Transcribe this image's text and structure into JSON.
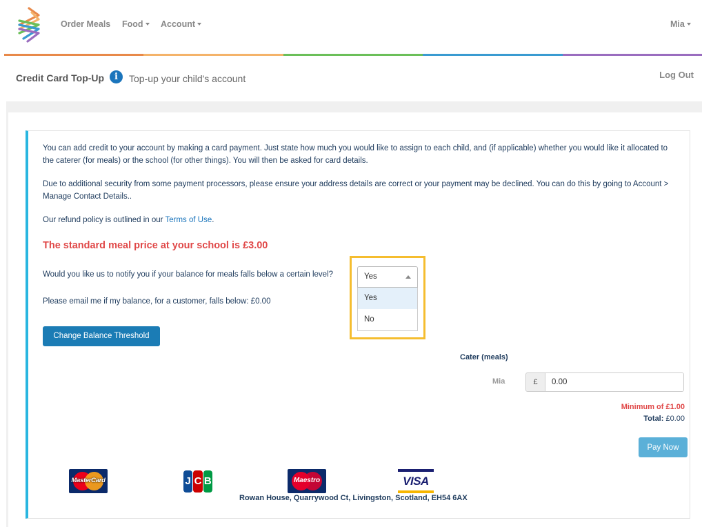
{
  "nav": {
    "items": [
      {
        "label": "Order Meals",
        "has_caret": false
      },
      {
        "label": "Food",
        "has_caret": true
      },
      {
        "label": "Account",
        "has_caret": true
      }
    ],
    "user_menu": "Mia"
  },
  "header": {
    "title": "Credit Card Top-Up",
    "subtitle": "Top-up your child's account",
    "info_icon": "i",
    "logout_label": "Log Out"
  },
  "intro": {
    "paragraph1": "You can add credit to your account by making a card payment. Just state how much you would like to assign to each child, and (if applicable) whether you would like it allocated to the caterer (for meals) or the school (for other things). You will then be asked for card details.",
    "paragraph2": "Due to additional security from some payment processors, please ensure your address details are correct or your payment may be declined. You can do this by going to Account > Manage Contact Details..",
    "refund_prefix": "Our refund policy is outlined in our ",
    "refund_link": "Terms of Use",
    "refund_suffix": "."
  },
  "meal_price_text": "The standard meal price at your school is £3.00",
  "notify": {
    "question": "Would you like us to notify you if your balance for meals falls below a certain level?",
    "threshold_text": "Please email me if my balance, for a customer, falls below: £0.00",
    "button_label": "Change Balance Threshold",
    "select": {
      "value": "Yes",
      "options": [
        "Yes",
        "No"
      ],
      "selected_index": 0
    }
  },
  "topup": {
    "column_header": "Cater (meals)",
    "child_name": "Mia",
    "currency_symbol": "£",
    "amount_value": "0.00",
    "minimum_text": "Minimum of £1.00",
    "total_label": "Total:",
    "total_value": "£0.00",
    "pay_button": "Pay Now"
  },
  "card_logos": {
    "mastercard": "MasterCard",
    "jcb": [
      "J",
      "C",
      "B"
    ],
    "maestro": "Maestro",
    "visa": "VISA"
  },
  "address": "Rowan House, Quarrywood Ct, Livingston, Scotland, EH54 6AX",
  "colors": {
    "stripe": [
      "#e8894a",
      "#f4b36a",
      "#6bbf59",
      "#3a9bd1",
      "#9a6dbf"
    ],
    "primary_button": "#1b7cb5",
    "pay_button": "#5bb0d8",
    "alert_red": "#e04848",
    "highlight": "#f5bd2f",
    "card_accent": "#29b6e0"
  }
}
